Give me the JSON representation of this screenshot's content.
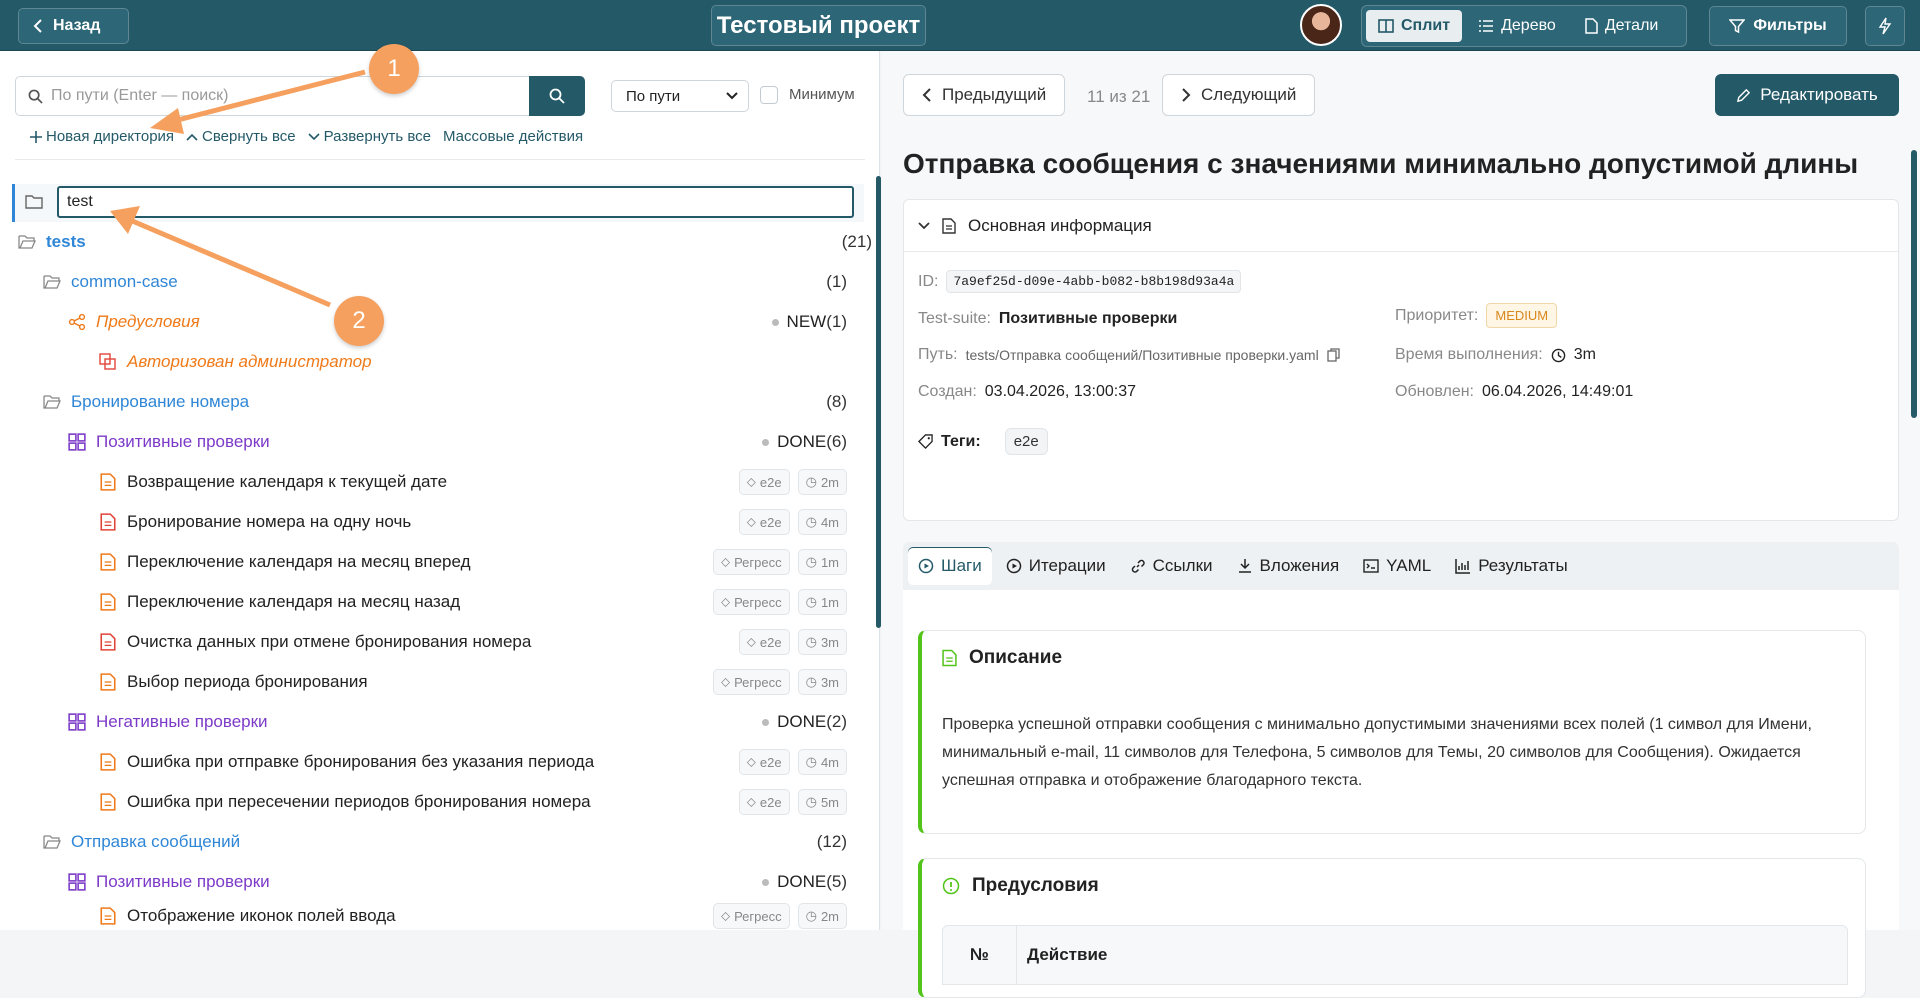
{
  "topbar": {
    "back_label": "Назад",
    "project_title": "Тестовый проект",
    "views": [
      "Сплит",
      "Дерево",
      "Детали"
    ],
    "filters_label": "Фильтры"
  },
  "left": {
    "search_placeholder": "По пути (Enter — поиск)",
    "search_mode": "По пути",
    "minimum_label": "Минимум",
    "actions": {
      "new_dir": "Новая директория",
      "collapse": "Свернуть все",
      "expand": "Развернуть все",
      "bulk": "Массовые действия"
    },
    "new_dir_input": "test",
    "tree": {
      "root": {
        "label": "tests",
        "count": "(21)"
      },
      "common_case": {
        "label": "common-case",
        "count": "(1)"
      },
      "preconditions": {
        "label": "Предусловия",
        "status": "NEW",
        "count": "(1)"
      },
      "precondition_item": "Авторизован администратор",
      "booking": {
        "label": "Бронирование номера",
        "count": "(8)"
      },
      "booking_positive": {
        "label": "Позитивные проверки",
        "status": "DONE",
        "count": "(6)"
      },
      "booking_positive_items": [
        {
          "label": "Возвращение календаря к текущей дате",
          "tag": "e2e",
          "time": "2m"
        },
        {
          "label": "Бронирование номера на одну ночь",
          "tag": "e2e",
          "time": "4m"
        },
        {
          "label": "Переключение календаря на месяц вперед",
          "tag": "Регресс",
          "time": "1m"
        },
        {
          "label": "Переключение календаря на месяц назад",
          "tag": "Регресс",
          "time": "1m"
        },
        {
          "label": "Очистка данных при отмене бронирования номера",
          "tag": "e2e",
          "time": "3m"
        },
        {
          "label": "Выбор периода бронирования",
          "tag": "Регресс",
          "time": "3m"
        }
      ],
      "booking_negative": {
        "label": "Негативные проверки",
        "status": "DONE",
        "count": "(2)"
      },
      "booking_negative_items": [
        {
          "label": "Ошибка при отправке бронирования без указания периода",
          "tag": "e2e",
          "time": "4m"
        },
        {
          "label": "Ошибка при пересечении периодов бронирования номера",
          "tag": "e2e",
          "time": "5m"
        }
      ],
      "messages": {
        "label": "Отправка сообщений",
        "count": "(12)"
      },
      "messages_positive": {
        "label": "Позитивные проверки",
        "status": "DONE",
        "count": "(5)"
      },
      "messages_positive_items": [
        {
          "label": "Отображение иконок полей ввода",
          "tag": "Регресс",
          "time": "2m"
        }
      ]
    },
    "annotations": [
      "1",
      "2"
    ]
  },
  "right": {
    "prev_label": "Предыдущий",
    "pager": "11 из 21",
    "next_label": "Следующий",
    "edit_label": "Редактировать",
    "title": "Отправка сообщения с значениями минимально допустимой длины",
    "info": {
      "header": "Основная информация",
      "id_label": "ID:",
      "id_value": "7a9ef25d-d09e-4abb-b082-b8b198d93a4a",
      "suite_label": "Test-suite:",
      "suite_value": "Позитивные проверки",
      "priority_label": "Приоритет:",
      "priority_value": "MEDIUM",
      "path_label": "Путь:",
      "path_value": "tests/Отправка сообщений/Позитивные проверки.yaml",
      "duration_label": "Время выполнения:",
      "duration_value": "3m",
      "created_label": "Создан:",
      "created_value": "03.04.2026, 13:00:37",
      "updated_label": "Обновлен:",
      "updated_value": "06.04.2026, 14:49:01",
      "tags_label": "Теги:",
      "tag_value": "e2e"
    },
    "tabs": [
      "Шаги",
      "Итерации",
      "Ссылки",
      "Вложения",
      "YAML",
      "Результаты"
    ],
    "description": {
      "title": "Описание",
      "text": "Проверка успешной отправки сообщения с минимально допустимыми значениями всех полей (1 символ для Имени, минимальный e-mail, 11 символов для Телефона, 5 символов для Темы, 20 символов для Сообщения). Ожидается успешная отправка и отображение благодарного текста."
    },
    "preconditions": {
      "title": "Предусловия",
      "col_num": "№",
      "col_action": "Действие"
    }
  },
  "colors": {
    "primary": "#245968",
    "dir": "#2f86d6",
    "suite": "#7c3ac8",
    "precondition": "#ef7a1a",
    "accent_green": "#52c41a"
  }
}
